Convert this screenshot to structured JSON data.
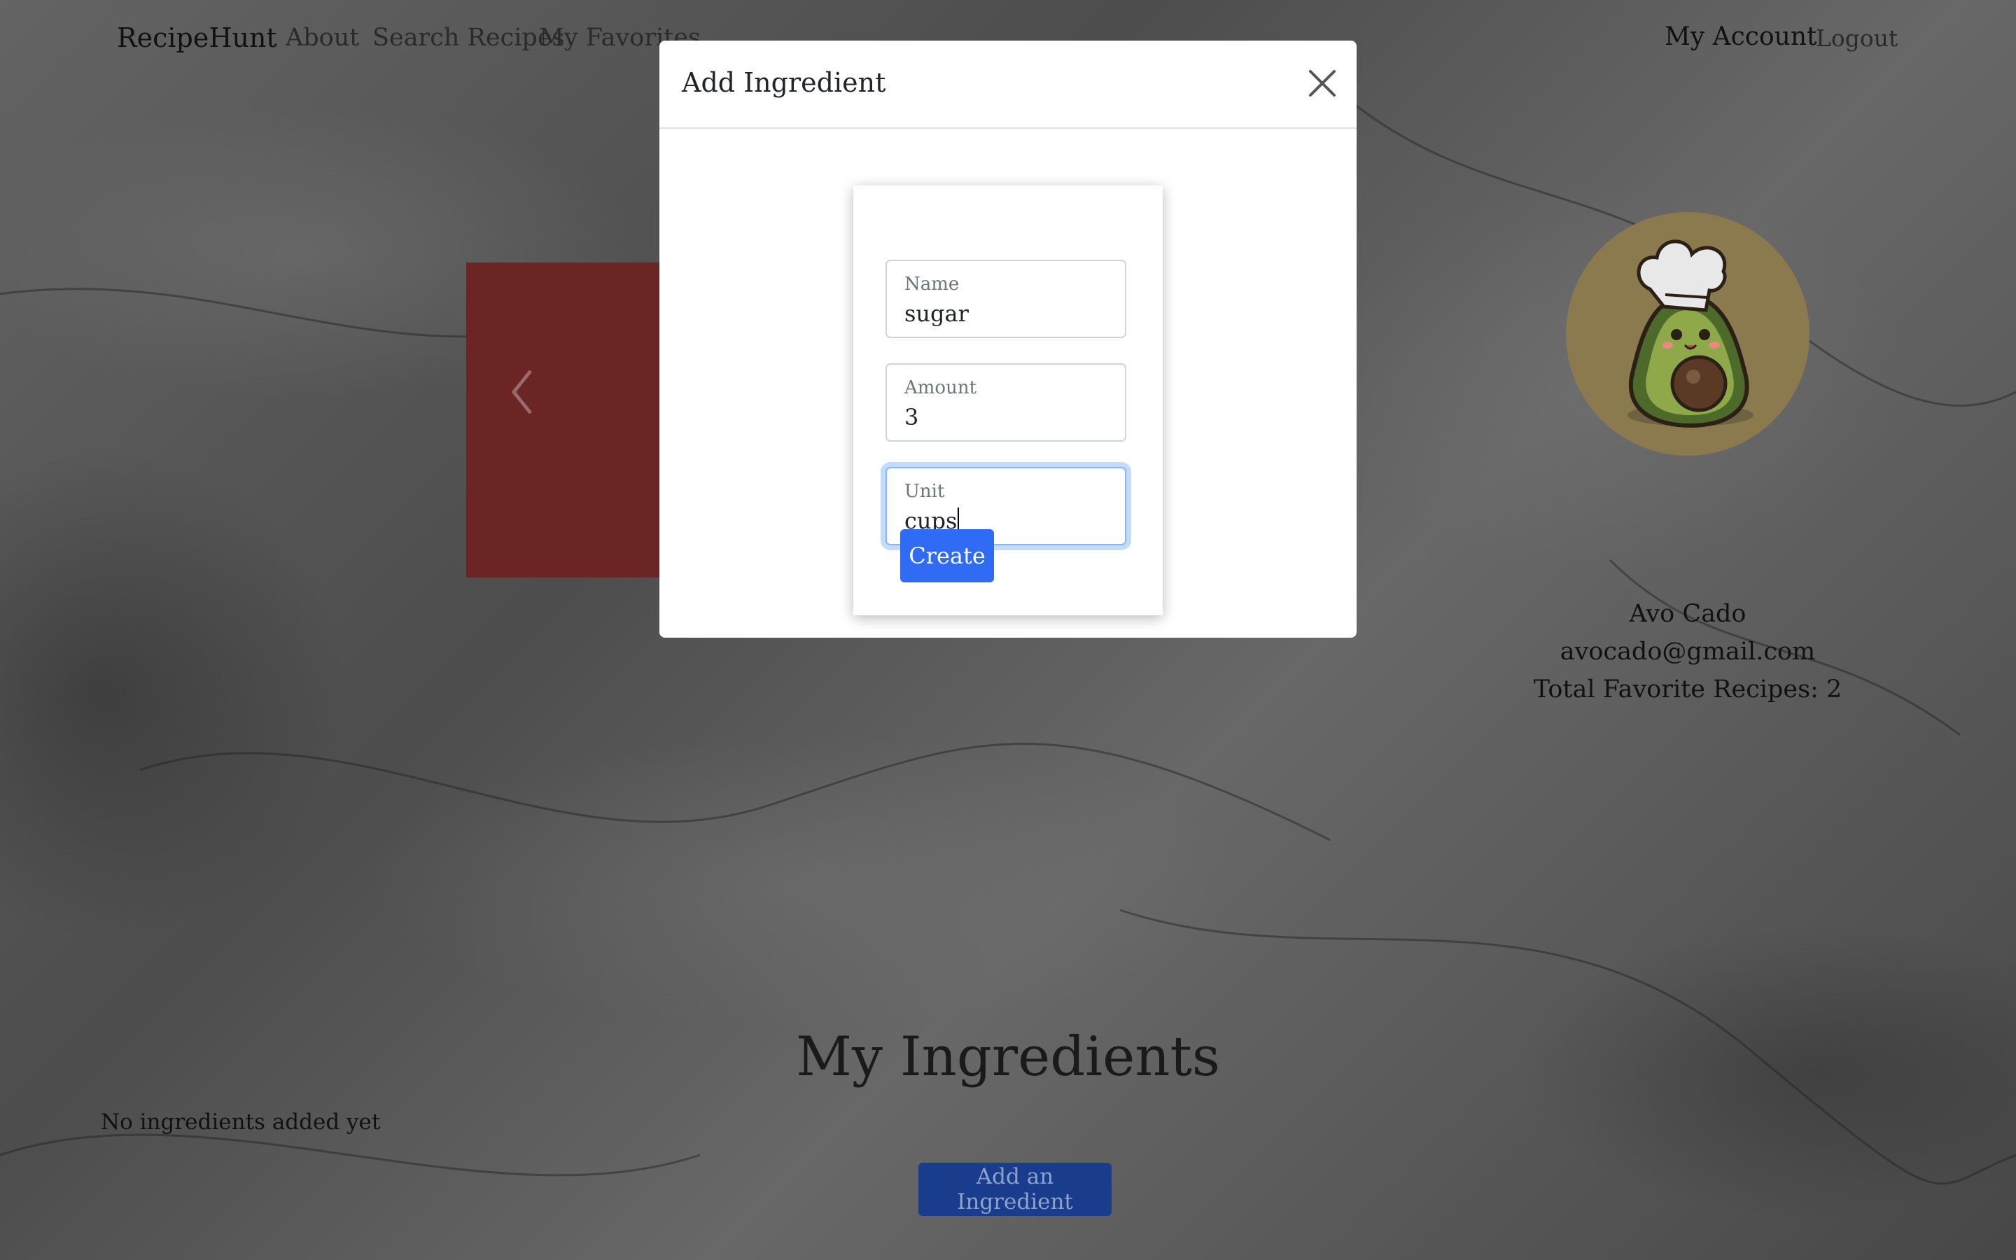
{
  "navbar": {
    "brand": "RecipeHunt",
    "links": [
      "About",
      "Search Recipes",
      "My Favorites"
    ],
    "account": "My Account",
    "logout": "Logout"
  },
  "profile": {
    "name": "Avo Cado",
    "email": "avocado@gmail.com",
    "favorites": "Total Favorite Recipes: 2"
  },
  "ingredients": {
    "title": "My Ingredients",
    "empty_text": "No ingredients added yet",
    "add_button": "Add an Ingredient"
  },
  "modal": {
    "title": "Add Ingredient",
    "fields": [
      {
        "label": "Name",
        "value": "sugar"
      },
      {
        "label": "Amount",
        "value": "3"
      },
      {
        "label": "Unit",
        "value": "cups"
      }
    ],
    "create_button": "Create"
  },
  "colors": {
    "primary": "#2f6bf5",
    "carousel": "#6b2525",
    "avatar_bg": "#8b7a4d"
  }
}
